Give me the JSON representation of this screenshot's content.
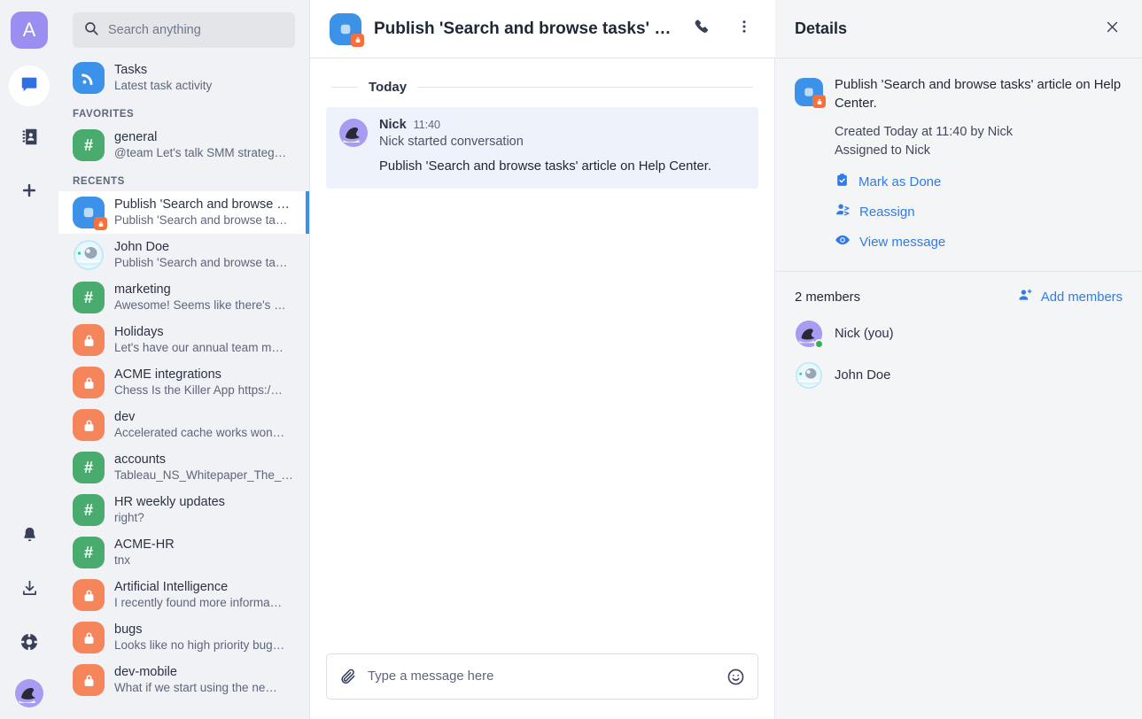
{
  "colors": {
    "accent_blue": "#3c8ef0",
    "link_blue": "#2f7ce8",
    "channel_green": "#4aab6e",
    "private_orange": "#f5855a",
    "task_blue": "#3b92e8",
    "workspace_purple": "#9a8ef0",
    "online_green": "#2eb54f",
    "sidebar_bg": "#f1f2f5",
    "details_bg": "#f4f5f7",
    "message_bg": "#eef2fb"
  },
  "rail": {
    "workspace_initial": "A",
    "items": [
      {
        "name": "chat-icon",
        "label": "Chats",
        "active": true
      },
      {
        "name": "contacts-icon",
        "label": "Contacts",
        "active": false
      },
      {
        "name": "plus-icon",
        "label": "Create",
        "active": false
      }
    ],
    "bottom_items": [
      {
        "name": "bell-icon",
        "label": "Notifications"
      },
      {
        "name": "download-icon",
        "label": "Downloads"
      },
      {
        "name": "lifebuoy-icon",
        "label": "Help"
      }
    ],
    "profile_avatar_label": "Nick"
  },
  "search": {
    "placeholder": "Search anything",
    "value": "",
    "icon": "search-icon"
  },
  "sidebar": {
    "pinned": {
      "title": "Tasks",
      "subtitle": "Latest task activity",
      "icon": "rss-feed-icon"
    },
    "sections": [
      {
        "label": "FAVORITES",
        "items": [
          {
            "title": "general",
            "subtitle": "@team Let's talk SMM strateg…",
            "icon": "hash-icon",
            "color": "green",
            "active": false
          }
        ]
      },
      {
        "label": "RECENTS",
        "items": [
          {
            "title": "Publish 'Search and browse …",
            "subtitle": "Publish 'Search and browse ta…",
            "icon": "task-icon",
            "color": "blue",
            "lock_badge": true,
            "active": true
          },
          {
            "title": "John Doe",
            "subtitle": "Publish 'Search and browse ta…",
            "icon": "avatar-robot",
            "color": "avatar",
            "active": false
          },
          {
            "title": "marketing",
            "subtitle": "Awesome! Seems like there's …",
            "icon": "hash-icon",
            "color": "green",
            "active": false
          },
          {
            "title": "Holidays",
            "subtitle": "Let's have our annual team m…",
            "icon": "lock-icon",
            "color": "orange",
            "active": false
          },
          {
            "title": "ACME integrations",
            "subtitle": "Chess Is the Killer App https:/…",
            "icon": "lock-icon",
            "color": "orange",
            "active": false
          },
          {
            "title": "dev",
            "subtitle": "Accelerated cache works won…",
            "icon": "lock-icon",
            "color": "orange",
            "active": false
          },
          {
            "title": "accounts",
            "subtitle": "Tableau_NS_Whitepaper_The_…",
            "icon": "hash-icon",
            "color": "green",
            "active": false
          },
          {
            "title": "HR weekly updates",
            "subtitle": "right?",
            "icon": "hash-icon",
            "color": "green",
            "active": false
          },
          {
            "title": "ACME-HR",
            "subtitle": "tnx",
            "icon": "hash-icon",
            "color": "green",
            "active": false
          },
          {
            "title": "Artificial Intelligence",
            "subtitle": "I recently found more informa…",
            "icon": "lock-icon",
            "color": "orange",
            "active": false
          },
          {
            "title": "bugs",
            "subtitle": "Looks like no high priority bug…",
            "icon": "lock-icon",
            "color": "orange",
            "active": false
          },
          {
            "title": "dev-mobile",
            "subtitle": "What if we start using the ne…",
            "icon": "lock-icon",
            "color": "orange",
            "active": false
          }
        ]
      }
    ]
  },
  "topbar": {
    "title": "Publish 'Search and browse tasks' article on Help Center.",
    "icon": "task-icon",
    "lock_badge": true,
    "actions": [
      {
        "name": "phone-icon",
        "label": "Call"
      },
      {
        "name": "more-vertical-icon",
        "label": "More options"
      }
    ]
  },
  "chat": {
    "day_separator": "Today",
    "messages": [
      {
        "author": "Nick",
        "time": "11:40",
        "meta": "Nick started conversation",
        "body": "Publish 'Search and browse tasks' article on Help Center.",
        "avatar": "nick-avatar"
      }
    ]
  },
  "composer": {
    "placeholder": "Type a message here",
    "value": "",
    "attach_icon": "paperclip-icon",
    "emoji_icon": "emoji-icon"
  },
  "details": {
    "title": "Details",
    "close_icon": "close-icon",
    "task": {
      "title": "Publish 'Search and browse tasks' article on Help Center.",
      "created": "Created Today at 11:40 by Nick",
      "assigned": "Assigned to Nick",
      "icon": "task-icon",
      "lock_badge": true
    },
    "actions": [
      {
        "label": "Mark as Done",
        "icon": "clipboard-check-icon"
      },
      {
        "label": "Reassign",
        "icon": "user-switch-icon"
      },
      {
        "label": "View message",
        "icon": "eye-icon"
      }
    ],
    "members": {
      "count_label": "2 members",
      "add_label": "Add members",
      "add_icon": "user-plus-icon",
      "list": [
        {
          "name": "Nick (you)",
          "avatar": "nick-avatar",
          "online": true
        },
        {
          "name": "John Doe",
          "avatar": "robot-avatar",
          "online": false
        }
      ]
    }
  }
}
